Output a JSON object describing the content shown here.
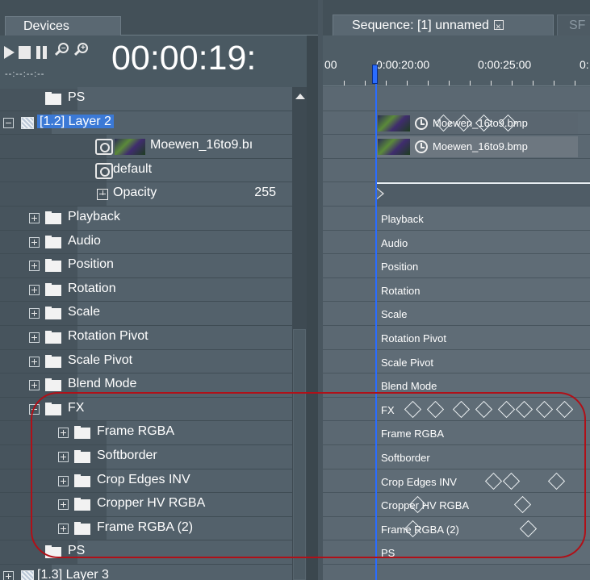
{
  "left_panel": {
    "tab_label": "Devices",
    "timecode": "00:00:19:",
    "timecode_small": "--:--:--:--",
    "transport": {
      "play_icon": "play-icon",
      "stop_icon": "stop-icon",
      "pause_icon": "pause-icon",
      "zoom_out_icon": "zoom-out-icon",
      "zoom_in_icon": "zoom-in-icon"
    },
    "tree": [
      {
        "label": "PS",
        "indent": 1,
        "type": "folder"
      },
      {
        "label": "[1.2] Layer 2",
        "indent": 0,
        "type": "layer",
        "expanded": true,
        "selected": true
      },
      {
        "label": "Moewen_16to9.bı",
        "indent": 2,
        "type": "clip"
      },
      {
        "label": "default",
        "indent": 2,
        "type": "default"
      },
      {
        "label": "Opacity",
        "indent": 2,
        "type": "opacity",
        "value": "255"
      },
      {
        "label": "Playback",
        "indent": 1,
        "type": "folder",
        "expanded": false
      },
      {
        "label": "Audio",
        "indent": 1,
        "type": "folder",
        "expanded": false
      },
      {
        "label": "Position",
        "indent": 1,
        "type": "folder",
        "expanded": false
      },
      {
        "label": "Rotation",
        "indent": 1,
        "type": "folder",
        "expanded": false
      },
      {
        "label": "Scale",
        "indent": 1,
        "type": "folder",
        "expanded": false
      },
      {
        "label": "Rotation Pivot",
        "indent": 1,
        "type": "folder",
        "expanded": false
      },
      {
        "label": "Scale Pivot",
        "indent": 1,
        "type": "folder",
        "expanded": false
      },
      {
        "label": "Blend Mode",
        "indent": 1,
        "type": "folder",
        "expanded": false
      },
      {
        "label": "FX",
        "indent": 1,
        "type": "folder",
        "expanded": true
      },
      {
        "label": "Frame RGBA",
        "indent": 2,
        "type": "folder",
        "expanded": false
      },
      {
        "label": "Softborder",
        "indent": 2,
        "type": "folder",
        "expanded": false
      },
      {
        "label": "Crop Edges INV",
        "indent": 2,
        "type": "folder",
        "expanded": false
      },
      {
        "label": "Cropper HV RGBA",
        "indent": 2,
        "type": "folder",
        "expanded": false
      },
      {
        "label": "Frame RGBA (2)",
        "indent": 2,
        "type": "folder",
        "expanded": false
      },
      {
        "label": "PS",
        "indent": 1,
        "type": "folder"
      },
      {
        "label": "[1.3] Layer 3",
        "indent": 0,
        "type": "layer",
        "expanded": false
      }
    ]
  },
  "right_panel": {
    "tab_label": "Sequence: [1] unnamed",
    "tab_close_icon": "close-icon",
    "second_tab_label": "SF",
    "ruler": {
      "labels": [
        "00",
        "0:00:20:00",
        "0:00:25:00",
        "0:"
      ]
    },
    "clips": [
      {
        "name": "Moewen_16to9.bmp"
      },
      {
        "name": "Moewen_16to9.bmp"
      }
    ],
    "track_labels": [
      "Playback",
      "Audio",
      "Position",
      "Rotation",
      "Scale",
      "Rotation Pivot",
      "Scale Pivot",
      "Blend Mode",
      "FX",
      "Frame RGBA",
      "Softborder",
      "Crop Edges INV",
      "Cropper HV RGBA",
      "Frame RGBA (2)",
      "PS"
    ]
  },
  "colors": {
    "panel_bg": "#47545d",
    "selection": "#3b79d6",
    "playhead": "#2a6cff",
    "highlight": "#b01018"
  }
}
